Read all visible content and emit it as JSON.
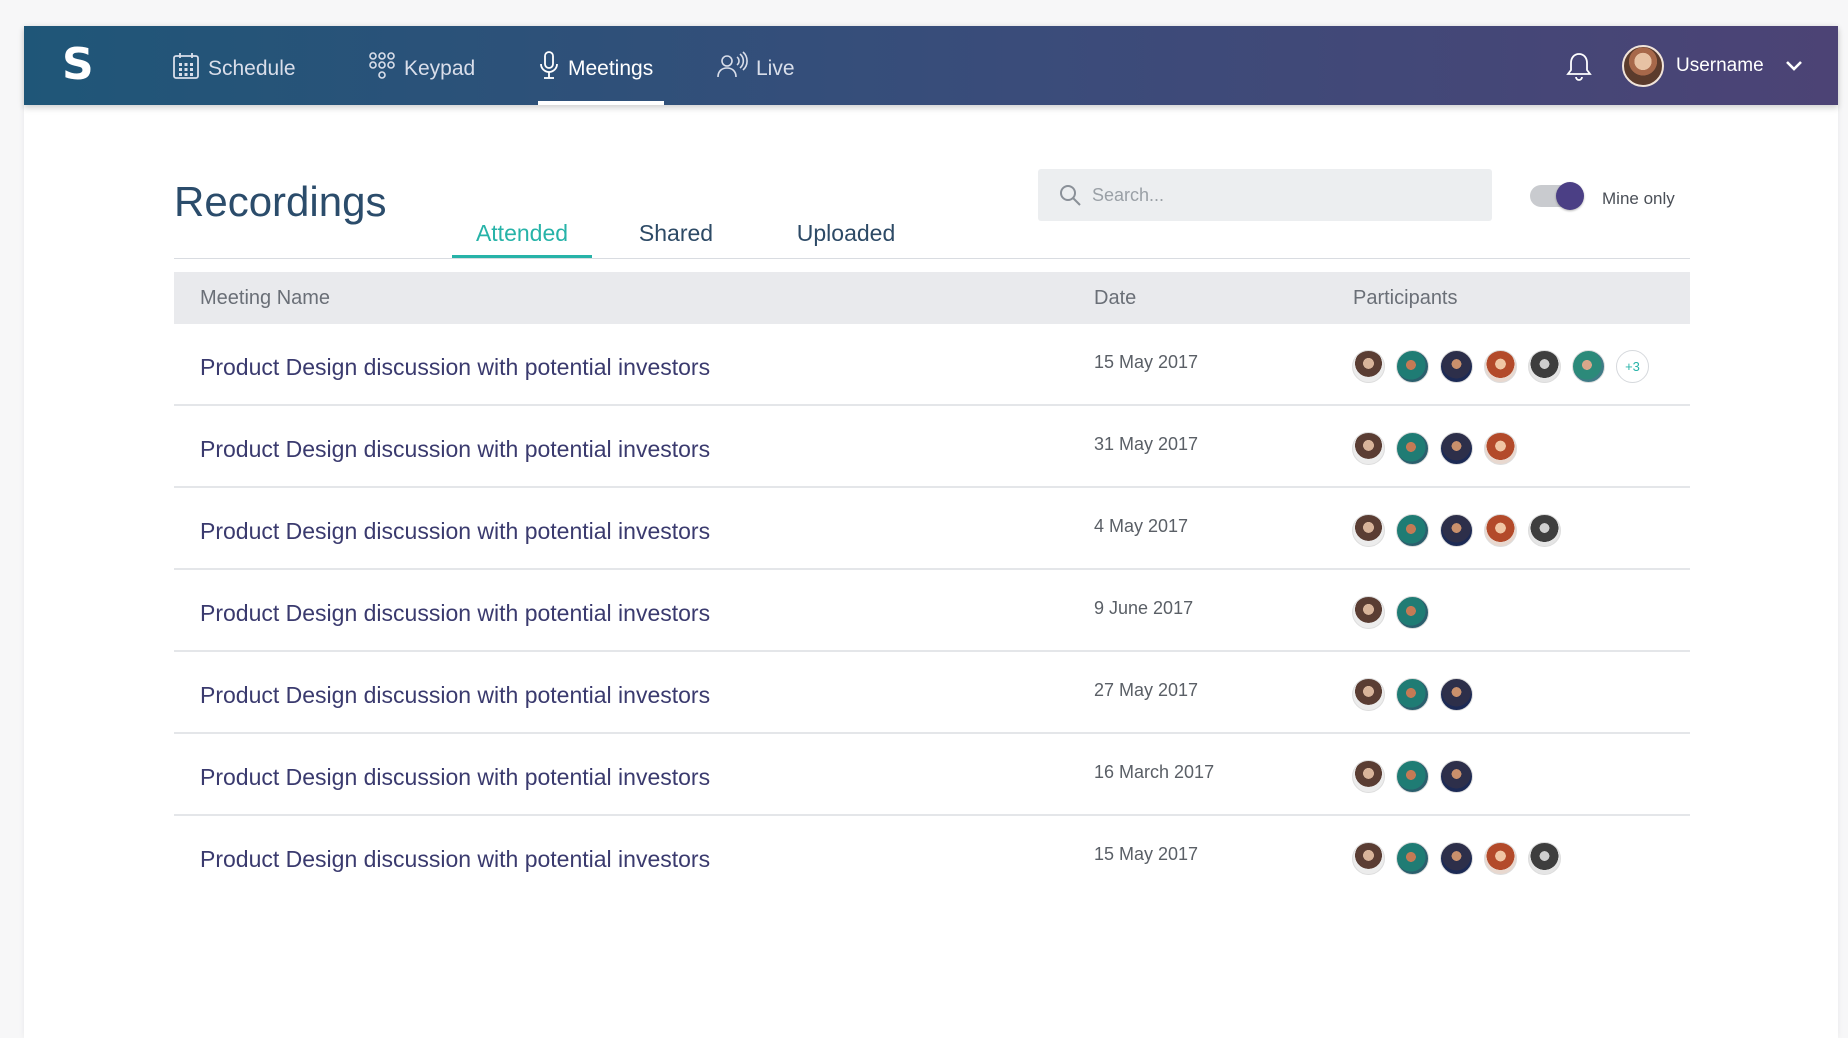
{
  "nav": {
    "logo": "S",
    "items": [
      {
        "label": "Schedule",
        "icon": "calendar-icon"
      },
      {
        "label": "Keypad",
        "icon": "keypad-icon"
      },
      {
        "label": "Meetings",
        "icon": "microphone-icon",
        "active": true
      },
      {
        "label": "Live",
        "icon": "live-audio-icon"
      }
    ],
    "username": "Username"
  },
  "page": {
    "title": "Recordings",
    "tabs": [
      {
        "label": "Attended",
        "active": true
      },
      {
        "label": "Shared"
      },
      {
        "label": "Uploaded"
      }
    ],
    "search_placeholder": "Search...",
    "mine_only_label": "Mine only",
    "mine_only_on": true
  },
  "table": {
    "headers": {
      "name": "Meeting Name",
      "date": "Date",
      "participants": "Participants"
    },
    "rows": [
      {
        "name": "Product Design discussion with potential investors",
        "date": "15 May 2017",
        "participants": 6,
        "more": "+3"
      },
      {
        "name": "Product Design discussion with potential investors",
        "date": "31 May 2017",
        "participants": 4
      },
      {
        "name": "Product Design discussion with potential investors",
        "date": "4 May 2017",
        "participants": 5
      },
      {
        "name": "Product Design discussion with potential investors",
        "date": "9 June 2017",
        "participants": 2
      },
      {
        "name": "Product Design discussion with potential investors",
        "date": "27 May 2017",
        "participants": 3
      },
      {
        "name": "Product Design discussion with potential investors",
        "date": "16 March 2017",
        "participants": 3
      },
      {
        "name": "Product Design discussion with potential investors",
        "date": "15 May 2017",
        "participants": 5
      }
    ]
  },
  "colors": {
    "accent": "#27b3a8",
    "nav_start": "#1f5678",
    "nav_end": "#4c4375",
    "toggle": "#4b3f85"
  }
}
